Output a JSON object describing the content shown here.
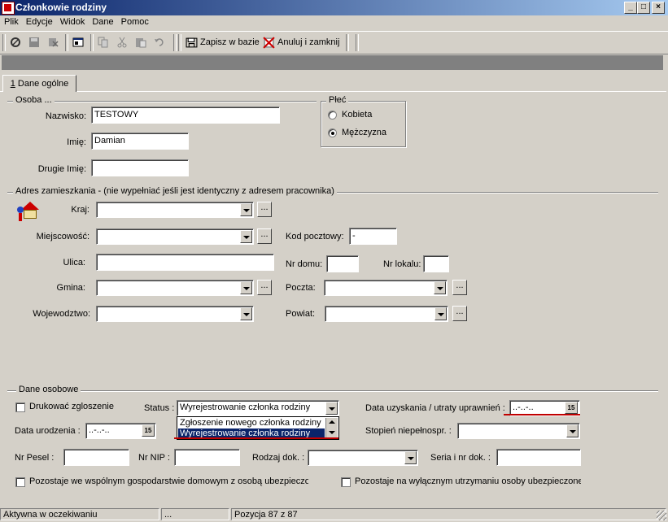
{
  "window": {
    "title": "Członkowie rodziny",
    "min": "_",
    "max": "□",
    "close": "×"
  },
  "menu": [
    "Plik",
    "Edycje",
    "Widok",
    "Dane",
    "Pomoc"
  ],
  "toolbar": {
    "save_label": "Zapisz w bazie",
    "cancel_label": "Anuluj i zamknij"
  },
  "tabs": [
    {
      "label": "1 Dane ogólne",
      "key": "1",
      "rest": " Dane ogólne"
    }
  ],
  "osoba": {
    "group_label": "Osoba ...",
    "nazwisko_label": "Nazwisko:",
    "nazwisko_value": "TESTOWY",
    "imie_label": "Imię:",
    "imie_value": "Damian",
    "drugie_imie_label": "Drugie Imię:",
    "drugie_imie_value": ""
  },
  "plec": {
    "group_label": "Płeć",
    "options": [
      {
        "label": "Kobieta",
        "checked": false
      },
      {
        "label": "Mężczyzna",
        "checked": true
      }
    ]
  },
  "adres": {
    "group_label": "Adres zamieszkania - (nie wypełniać jeśli jest identyczny z adresem pracownika)",
    "kraj_label": "Kraj:",
    "kraj_value": "",
    "miejscowosc_label": "Miejscowość:",
    "miejscowosc_value": "",
    "kod_label": "Kod pocztowy:",
    "kod_value": "-",
    "ulica_label": "Ulica:",
    "ulica_value": "",
    "nr_domu_label": "Nr domu:",
    "nr_domu_value": "",
    "nr_lokalu_label": "Nr lokalu:",
    "nr_lokalu_value": "",
    "gmina_label": "Gmina:",
    "gmina_value": "",
    "poczta_label": "Poczta:",
    "poczta_value": "",
    "wojewodztwo_label": "Wojewodztwo:",
    "wojewodztwo_value": "",
    "powiat_label": "Powiat:",
    "powiat_value": "",
    "browse": "..."
  },
  "dane": {
    "group_label": "Dane osobowe",
    "drukowac_label": "Drukować zgloszenie",
    "status_label": "Status :",
    "status_value": "Wyrejestrowanie członka rodziny",
    "status_options": [
      "Zgłoszenie nowego członka rodziny",
      "Wyrejestrowanie członka rodziny"
    ],
    "data_uzyskania_label": "Data uzyskania / utraty uprawnień :",
    "data_uzyskania_value": "..-..-..",
    "data_urodzenia_label": "Data urodzenia :",
    "data_urodzenia_value": "..-..-..",
    "calendar": "15",
    "stopien_label": "Stopień niepełnospr. :",
    "stopien_value": "",
    "pesel_label": "Nr Pesel :",
    "pesel_value": "",
    "nip_label": "Nr NIP :",
    "nip_value": "",
    "rodzaj_label": "Rodzaj dok. :",
    "rodzaj_value": "",
    "seria_label": "Seria i nr dok. :",
    "seria_value": "",
    "wspolne_label": "Pozostaje we wspólnym gospodarstwie domowym z osobą ubezpieczoną",
    "utrzymanie_label": "Pozostaje na wyłącznym utrzymaniu osoby ubezpieczonej"
  },
  "status": {
    "state": "Aktywna w oczekiwaniu",
    "middle": "...",
    "position": "Pozycja 87 z 87"
  }
}
